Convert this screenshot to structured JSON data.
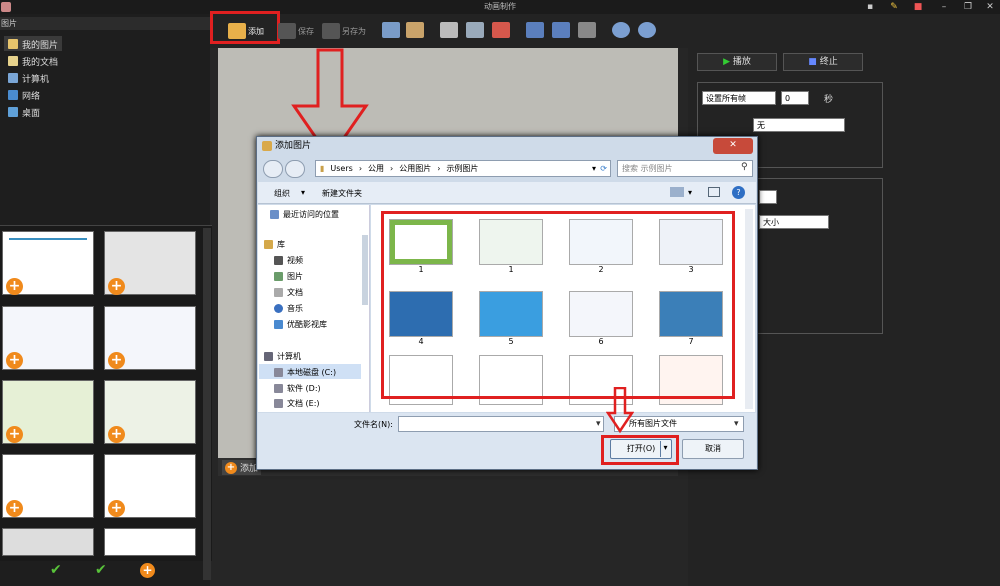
{
  "app": {
    "title": "动画制作"
  },
  "toolbar": {
    "add": "添加",
    "save": "保存",
    "save_as": "另存为"
  },
  "left": {
    "header": "图片",
    "tree": [
      {
        "label": "我的图片",
        "icon": "pictures-folder-icon"
      },
      {
        "label": "我的文档",
        "icon": "documents-folder-icon"
      },
      {
        "label": "计算机",
        "icon": "computer-icon"
      },
      {
        "label": "网络",
        "icon": "network-icon"
      },
      {
        "label": "桌面",
        "icon": "desktop-icon"
      }
    ]
  },
  "canvas": {
    "add_label": "添加"
  },
  "right": {
    "play": "播放",
    "stop": "终止",
    "frame_setting": "设置所有帧",
    "frame_value": "0",
    "seconds": "秒",
    "effect": "无",
    "size": "大小"
  },
  "dialog": {
    "title": "添加图片",
    "path": [
      "Users",
      "公用",
      "公用图片",
      "示例图片"
    ],
    "search_placeholder": "搜索 示例图片",
    "organize": "组织",
    "new_folder": "新建文件夹",
    "nav": {
      "recent": "最近访问的位置",
      "library": "库",
      "video": "视频",
      "pictures": "图片",
      "documents": "文档",
      "music": "音乐",
      "youku": "优酷影视库",
      "computer": "计算机",
      "local_disk": "本地磁盘 (C:)",
      "software": "软件 (D:)",
      "docs_drive": "文档 (E:)"
    },
    "files": [
      "1",
      "1",
      "2",
      "3",
      "4",
      "5",
      "6",
      "7"
    ],
    "file_label": "文件名(N):",
    "file_type": "所有图片文件",
    "open": "打开(O)",
    "cancel": "取消"
  },
  "colors": {
    "highlight": "#e02020",
    "accent": "#f08a1c",
    "check": "#58c23a"
  }
}
